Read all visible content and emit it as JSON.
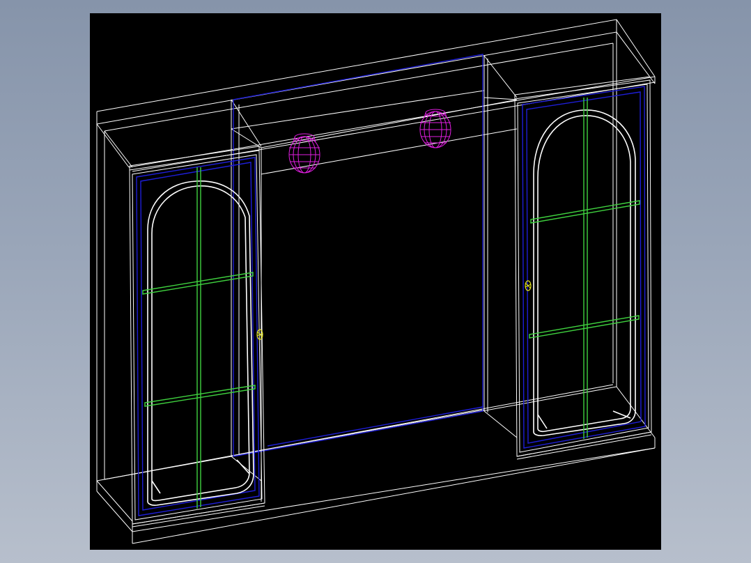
{
  "drawing": {
    "background": "#000000",
    "colors": {
      "outline": "#ffffff",
      "panel": "#1e1ed8",
      "glass_rail": "#3fd23f",
      "lamp": "#e01ee0",
      "handle": "#e6e61e"
    },
    "parts": [
      "cabinet-frame",
      "mirror-panel",
      "left-door",
      "right-door",
      "lamp-left",
      "lamp-right",
      "handle-left",
      "handle-right"
    ]
  }
}
